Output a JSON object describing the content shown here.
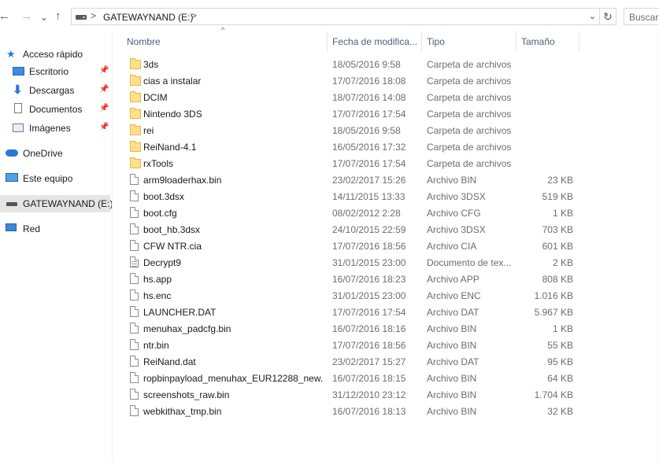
{
  "toolbar": {
    "back_icon": "←",
    "forward_icon": "→",
    "recent_icon": "⌄",
    "up_icon": "↑",
    "breadcrumb_sep": ">",
    "path": "GATEWAYNAND (E:)",
    "refresh_icon": "↻",
    "search_placeholder": "Buscar"
  },
  "sidebar": {
    "items": [
      {
        "label": "Acceso rápido",
        "icon": "star-icon",
        "pinned": false
      },
      {
        "label": "Escritorio",
        "icon": "desktop-icon",
        "pinned": true
      },
      {
        "label": "Descargas",
        "icon": "download-icon",
        "pinned": true
      },
      {
        "label": "Documentos",
        "icon": "documents-icon",
        "pinned": true
      },
      {
        "label": "Imágenes",
        "icon": "pictures-icon",
        "pinned": true
      },
      {
        "label": "OneDrive",
        "icon": "cloud-icon",
        "pinned": false
      },
      {
        "label": "Este equipo",
        "icon": "computer-icon",
        "pinned": false
      },
      {
        "label": "GATEWAYNAND (E:)",
        "icon": "drive-icon",
        "pinned": false,
        "selected": true
      },
      {
        "label": "Red",
        "icon": "network-icon",
        "pinned": false
      }
    ]
  },
  "columns": {
    "name": "Nombre",
    "date": "Fecha de modifica...",
    "type": "Tipo",
    "size": "Tamaño",
    "sort_icon": "^"
  },
  "files": [
    {
      "name": "3ds",
      "date": "18/05/2016 9:58",
      "type": "Carpeta de archivos",
      "size": "",
      "kind": "folder"
    },
    {
      "name": "cias a instalar",
      "date": "17/07/2016 18:08",
      "type": "Carpeta de archivos",
      "size": "",
      "kind": "folder"
    },
    {
      "name": "DCIM",
      "date": "18/07/2016 14:08",
      "type": "Carpeta de archivos",
      "size": "",
      "kind": "folder"
    },
    {
      "name": "Nintendo 3DS",
      "date": "17/07/2016 17:54",
      "type": "Carpeta de archivos",
      "size": "",
      "kind": "folder"
    },
    {
      "name": "rei",
      "date": "18/05/2016 9:58",
      "type": "Carpeta de archivos",
      "size": "",
      "kind": "folder"
    },
    {
      "name": "ReiNand-4.1",
      "date": "16/05/2016 17:32",
      "type": "Carpeta de archivos",
      "size": "",
      "kind": "folder"
    },
    {
      "name": "rxTools",
      "date": "17/07/2016 17:54",
      "type": "Carpeta de archivos",
      "size": "",
      "kind": "folder"
    },
    {
      "name": "arm9loaderhax.bin",
      "date": "23/02/2017 15:26",
      "type": "Archivo BIN",
      "size": "23 KB",
      "kind": "file"
    },
    {
      "name": "boot.3dsx",
      "date": "14/11/2015 13:33",
      "type": "Archivo 3DSX",
      "size": "519 KB",
      "kind": "file"
    },
    {
      "name": "boot.cfg",
      "date": "08/02/2012 2:28",
      "type": "Archivo CFG",
      "size": "1 KB",
      "kind": "file"
    },
    {
      "name": "boot_hb.3dsx",
      "date": "24/10/2015 22:59",
      "type": "Archivo 3DSX",
      "size": "703 KB",
      "kind": "file"
    },
    {
      "name": "CFW NTR.cia",
      "date": "17/07/2016 18:56",
      "type": "Archivo CIA",
      "size": "601 KB",
      "kind": "file"
    },
    {
      "name": "Decrypt9",
      "date": "31/01/2015 23:00",
      "type": "Documento de tex...",
      "size": "2 KB",
      "kind": "text"
    },
    {
      "name": "hs.app",
      "date": "16/07/2016 18:23",
      "type": "Archivo APP",
      "size": "808 KB",
      "kind": "file"
    },
    {
      "name": "hs.enc",
      "date": "31/01/2015 23:00",
      "type": "Archivo ENC",
      "size": "1.016 KB",
      "kind": "file"
    },
    {
      "name": "LAUNCHER.DAT",
      "date": "17/07/2016 17:54",
      "type": "Archivo DAT",
      "size": "5.967 KB",
      "kind": "file"
    },
    {
      "name": "menuhax_padcfg.bin",
      "date": "16/07/2016 18:16",
      "type": "Archivo BIN",
      "size": "1 KB",
      "kind": "file"
    },
    {
      "name": "ntr.bin",
      "date": "17/07/2016 18:56",
      "type": "Archivo BIN",
      "size": "55 KB",
      "kind": "file"
    },
    {
      "name": "ReiNand.dat",
      "date": "23/02/2017 15:27",
      "type": "Archivo DAT",
      "size": "95 KB",
      "kind": "file"
    },
    {
      "name": "ropbinpayload_menuhax_EUR12288_new...",
      "date": "16/07/2016 18:15",
      "type": "Archivo BIN",
      "size": "64 KB",
      "kind": "file"
    },
    {
      "name": "screenshots_raw.bin",
      "date": "31/12/2010 23:12",
      "type": "Archivo BIN",
      "size": "1.704 KB",
      "kind": "file"
    },
    {
      "name": "webkithax_tmp.bin",
      "date": "16/07/2016 18:13",
      "type": "Archivo BIN",
      "size": "32 KB",
      "kind": "file"
    }
  ]
}
